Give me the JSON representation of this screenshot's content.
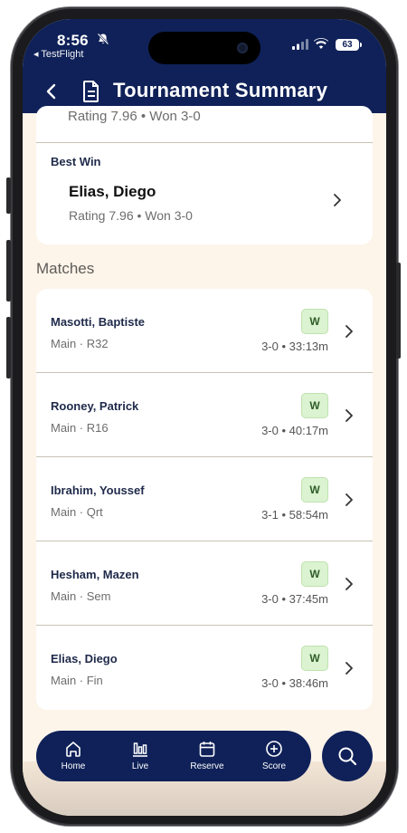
{
  "status_bar": {
    "time": "8:56",
    "back_app": "◂ TestFlight",
    "battery": "63"
  },
  "header": {
    "title": "Tournament Summary"
  },
  "best_win": {
    "clipped_line": "Rating 7.96 • Won 3-0",
    "label": "Best Win",
    "name": "Elias, Diego",
    "detail": "Rating 7.96 • Won 3-0"
  },
  "matches": {
    "section_title": "Matches",
    "items": [
      {
        "name": "Masotti, Baptiste",
        "round": "Main · R32",
        "result": "W",
        "score": "3-0 • 33:13m"
      },
      {
        "name": "Rooney, Patrick",
        "round": "Main · R16",
        "result": "W",
        "score": "3-0 • 40:17m"
      },
      {
        "name": "Ibrahim, Youssef",
        "round": "Main · Qrt",
        "result": "W",
        "score": "3-1 • 58:54m"
      },
      {
        "name": "Hesham, Mazen",
        "round": "Main · Sem",
        "result": "W",
        "score": "3-0 • 37:45m"
      },
      {
        "name": "Elias, Diego",
        "round": "Main · Fin",
        "result": "W",
        "score": "3-0 • 38:46m"
      }
    ]
  },
  "nav": {
    "items": [
      {
        "label": "Home",
        "icon": "home-icon"
      },
      {
        "label": "Live",
        "icon": "live-chart-icon"
      },
      {
        "label": "Reserve",
        "icon": "calendar-icon"
      },
      {
        "label": "Score",
        "icon": "plus-circle-icon"
      }
    ],
    "search_icon": "search-icon"
  },
  "colors": {
    "header_bg": "#0f2158",
    "page_bg": "#fdf4ea",
    "win_badge_bg": "#dbf3d1",
    "win_badge_text": "#2f5d28"
  }
}
